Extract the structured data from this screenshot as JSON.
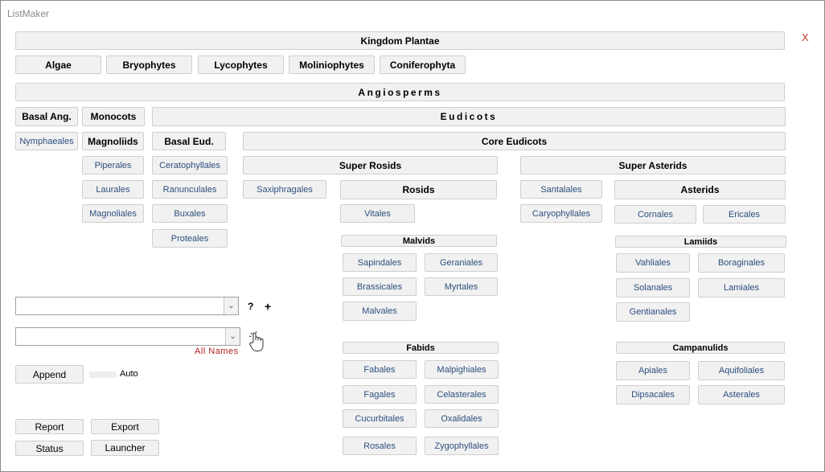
{
  "window": {
    "title": "ListMaker",
    "close_label": "X"
  },
  "headers": {
    "kingdom": "Kingdom Plantae",
    "angiosperms": "Angiosperms",
    "eudicots": "Eudicots",
    "basal_ang": "Basal Ang.",
    "monocots": "Monocots",
    "magnoliids": "Magnoliids",
    "basal_eud": "Basal Eud.",
    "core_eudicots": "Core Eudicots",
    "super_rosids": "Super Rosids",
    "super_asterids": "Super Asterids",
    "rosids": "Rosids",
    "asterids": "Asterids",
    "malvids": "Malvids",
    "fabids": "Fabids",
    "lamiids": "Lamiids",
    "campanulids": "Campanulids"
  },
  "groups": {
    "algae": "Algae",
    "bryophytes": "Bryophytes",
    "lycophytes": "Lycophytes",
    "moliniophytes": "Moliniophytes",
    "coniferophyta": "Coniferophyta"
  },
  "orders": {
    "nymphaeales": "Nymphaeales",
    "piperales": "Piperales",
    "laurales": "Laurales",
    "magnoliales": "Magnoliales",
    "ceratophyllales": "Ceratophyllales",
    "ranunculales": "Ranunculales",
    "buxales": "Buxales",
    "proteales": "Proteales",
    "saxiphragales": "Saxiphragales",
    "vitales": "Vitales",
    "santalales": "Santalales",
    "caryophyllales": "Caryophyllales",
    "cornales": "Cornales",
    "ericales": "Ericales",
    "sapindales": "Sapindales",
    "geraniales": "Geraniales",
    "brassicales": "Brassicales",
    "myrtales": "Myrtales",
    "malvales": "Malvales",
    "fabales": "Fabales",
    "malpighiales": "Malpighiales",
    "fagales": "Fagales",
    "celasterales": "Celasterales",
    "cucurbitales": "Cucurbitales",
    "oxalidales": "Oxalidales",
    "rosales": "Rosales",
    "zygophyllales": "Zygophyllales",
    "vahliales": "Vahliales",
    "boraginales": "Boraginales",
    "solanales": "Solanales",
    "lamiales": "Lamiales",
    "gentianales": "Gentianales",
    "apiales": "Apiales",
    "aquifoliales": "Aquifoliales",
    "dipsacales": "Dipsacales",
    "asterales": "Asterales"
  },
  "controls": {
    "combo1_value": "",
    "help_label": "?",
    "plus_label": "+",
    "combo2_value": "",
    "all_names": "All Names",
    "append": "Append",
    "auto": "Auto",
    "report": "Report",
    "export": "Export",
    "status": "Status",
    "launcher": "Launcher"
  },
  "colors": {
    "button_bg": "#f1f1f1",
    "button_border": "#cfcfcf",
    "link_text": "#2c4f7e",
    "accent_red": "#b22222"
  }
}
